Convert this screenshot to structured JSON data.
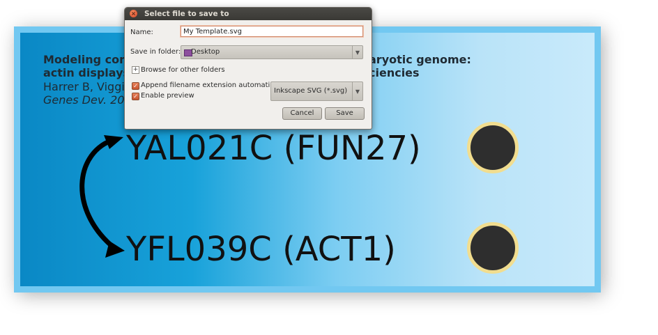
{
  "slide": {
    "ref_title_line1": "Modeling com",
    "ref_title_line2": "actin displays",
    "ref_title_right_line1": "aryotic genome:",
    "ref_title_right_line2": "ciencies",
    "ref_authors": "Harrer B, Viggia",
    "ref_journal": "Genes Dev. 200",
    "gene_1": "YAL021C (FUN27)",
    "gene_2": "YFL039C (ACT1)"
  },
  "dialog": {
    "title": "Select file to save to",
    "close_glyph": "×",
    "name_label": "Name:",
    "name_value": "My Template.svg",
    "folder_label": "Save in folder:",
    "folder_value": "Desktop",
    "browse_label": "Browse for other folders",
    "expander_glyph": "+",
    "append_label": "Append filename extension automatically",
    "append_checked": true,
    "preview_label": "Enable preview",
    "preview_checked": true,
    "filetype_value": "Inkscape SVG (*.svg)",
    "combo_arrow_glyph": "▼",
    "check_glyph": "✓",
    "cancel_label": "Cancel",
    "save_label": "Save"
  },
  "colors": {
    "slide_border": "#72c8f1",
    "gradient_left": "#0a88c5",
    "gradient_right": "#c9eafb",
    "dot_fill": "#2e2e2e",
    "dot_ring": "#f1dd8f",
    "titlebar": "#3a3935"
  }
}
